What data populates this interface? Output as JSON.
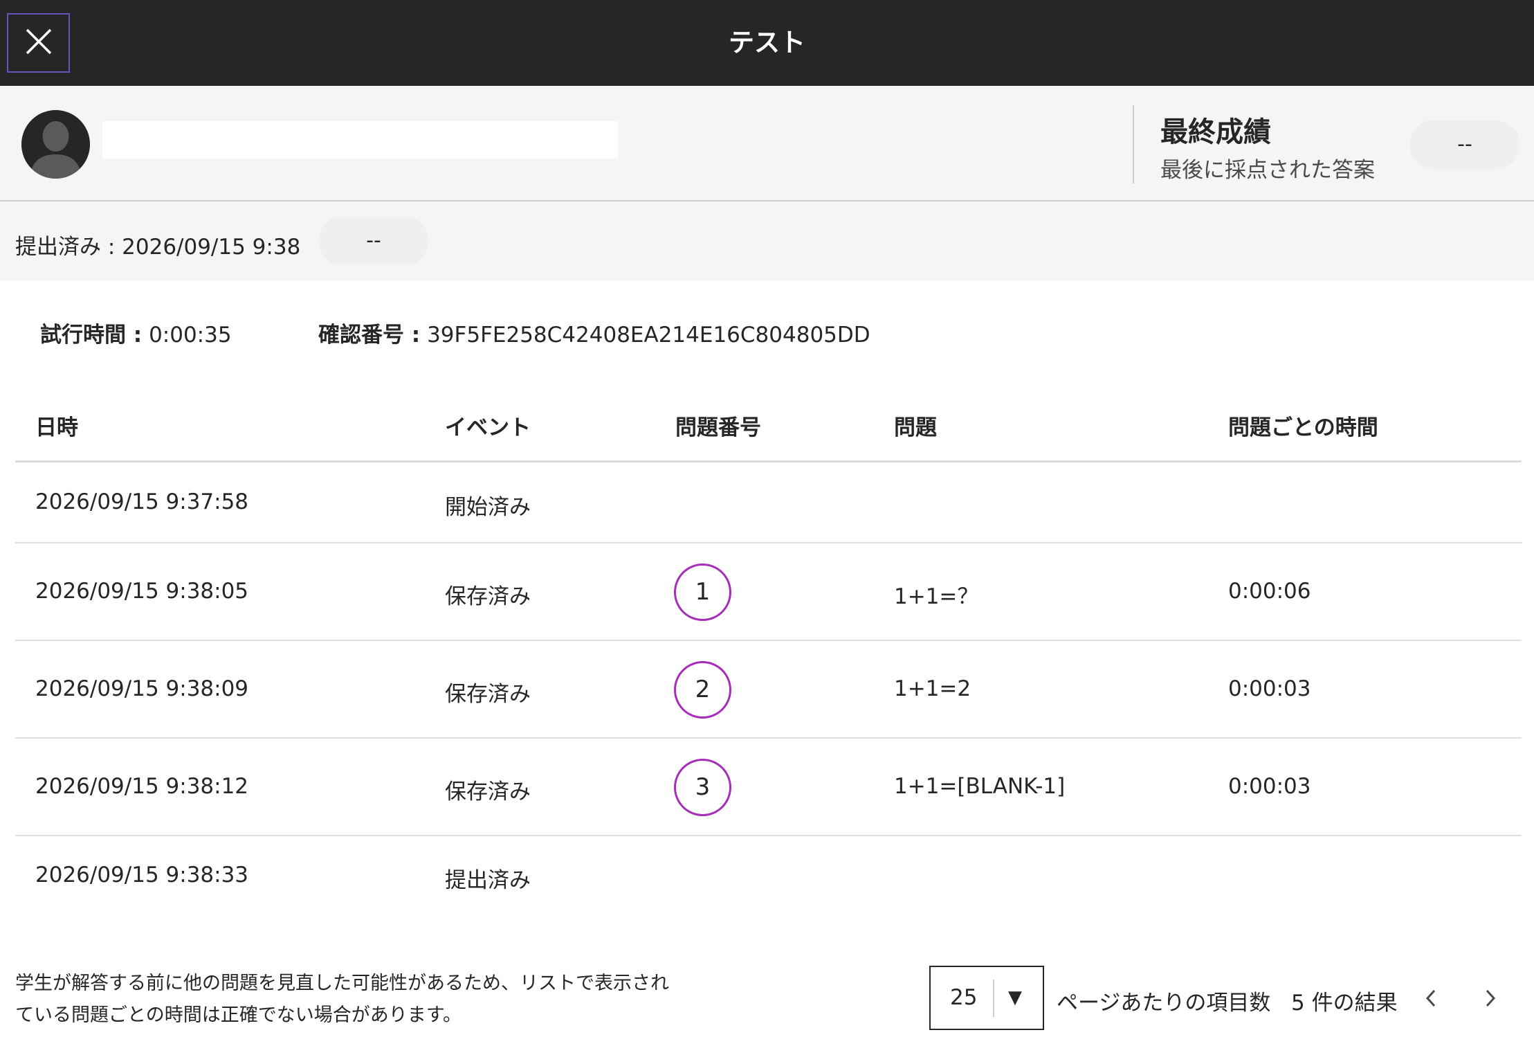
{
  "header": {
    "title": "テスト",
    "close_icon": "close-icon"
  },
  "student": {
    "avatar_icon": "user-avatar-icon",
    "final_grade_title": "最終成績",
    "final_grade_sub": "最後に採点された答案",
    "final_grade_value": "--"
  },
  "submission": {
    "label": "提出済み : 2026/09/15 9:38",
    "grade_value": "--"
  },
  "meta": {
    "attempt_time_label": "試行時間 :",
    "attempt_time_value": "0:00:35",
    "confirmation_label": "確認番号 :",
    "confirmation_value": "39F5FE258C42408EA214E16C804805DD"
  },
  "table": {
    "headers": {
      "datetime": "日時",
      "event": "イベント",
      "question_number": "問題番号",
      "question": "問題",
      "time_per_question": "問題ごとの時間"
    },
    "rows": [
      {
        "datetime": "2026/09/15 9:37:58",
        "event": "開始済み",
        "number": "",
        "question": "",
        "time": ""
      },
      {
        "datetime": "2026/09/15 9:38:05",
        "event": "保存済み",
        "number": "1",
        "question": "1+1=？",
        "time": "0:00:06"
      },
      {
        "datetime": "2026/09/15 9:38:09",
        "event": "保存済み",
        "number": "2",
        "question": "1+1=2",
        "time": "0:00:03"
      },
      {
        "datetime": "2026/09/15 9:38:12",
        "event": "保存済み",
        "number": "3",
        "question": "1+1=[BLANK-1]",
        "time": "0:00:03"
      },
      {
        "datetime": "2026/09/15 9:38:33",
        "event": "提出済み",
        "number": "",
        "question": "",
        "time": ""
      }
    ]
  },
  "footer": {
    "note_line1": "学生が解答する前に他の問題を見直した可能性があるため、リストで表示され",
    "note_line2": "ている問題ごとの時間は正確でない場合があります。",
    "page_size": "25",
    "per_page_label": "ページあたりの項目数",
    "results_label": "5 件の結果",
    "prev_icon": "chevron-left-icon",
    "next_icon": "chevron-right-icon"
  },
  "colors": {
    "header_bg": "#262626",
    "accent_purple": "#a62eb8",
    "close_border": "#6b4fbb",
    "panel_bg": "#f5f5f5"
  }
}
